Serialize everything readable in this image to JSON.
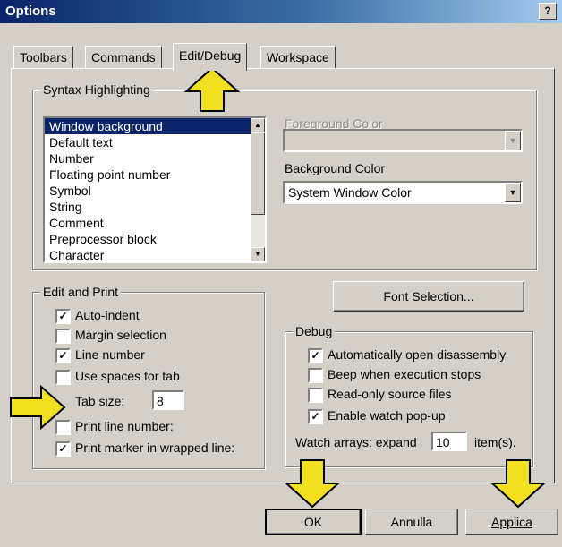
{
  "window": {
    "title": "Options",
    "help_glyph": "?"
  },
  "tabs": [
    {
      "label": "Toolbars",
      "active": false
    },
    {
      "label": "Commands",
      "active": false
    },
    {
      "label": "Edit/Debug",
      "active": true
    },
    {
      "label": "Workspace",
      "active": false
    }
  ],
  "syntax": {
    "group_title": "Syntax Highlighting",
    "items": [
      "Window background",
      "Default text",
      "Number",
      "Floating point number",
      "Symbol",
      "String",
      "Comment",
      "Preprocessor block",
      "Character"
    ],
    "selected_index": 0,
    "foreground_label": "Foreground Color",
    "foreground_value": "",
    "background_label": "Background Color",
    "background_value": "System Window Color"
  },
  "edit_print": {
    "group_title": "Edit and Print",
    "options": [
      {
        "label": "Auto-indent",
        "checked": true
      },
      {
        "label": "Margin selection",
        "checked": false
      },
      {
        "label": "Line number",
        "checked": true
      },
      {
        "label": "Use spaces for tab",
        "checked": false
      }
    ],
    "tab_size_label": "Tab size:",
    "tab_size_value": "8",
    "print_options": [
      {
        "label": "Print line number:",
        "checked": false
      },
      {
        "label": "Print marker in wrapped line:",
        "checked": true
      }
    ]
  },
  "font_selection_button": "Font Selection...",
  "debug": {
    "group_title": "Debug",
    "options": [
      {
        "label": "Automatically open disassembly",
        "checked": true
      },
      {
        "label": "Beep when execution stops",
        "checked": false
      },
      {
        "label": "Read-only source files",
        "checked": false
      },
      {
        "label": "Enable watch pop-up",
        "checked": true
      }
    ],
    "watch_prefix": "Watch arrays: expand",
    "watch_value": "10",
    "watch_suffix": "item(s)."
  },
  "footer": {
    "ok": "OK",
    "cancel": "Annulla",
    "apply": "Applica"
  },
  "colors": {
    "title_start": "#0a246a",
    "title_end": "#a6caf0",
    "face": "#d4d0c8",
    "selection": "#0a246a",
    "arrow_fill": "#f0e020"
  },
  "icons": {
    "check": "✓",
    "down_arrow": "▼",
    "up_arrow": "▲"
  }
}
